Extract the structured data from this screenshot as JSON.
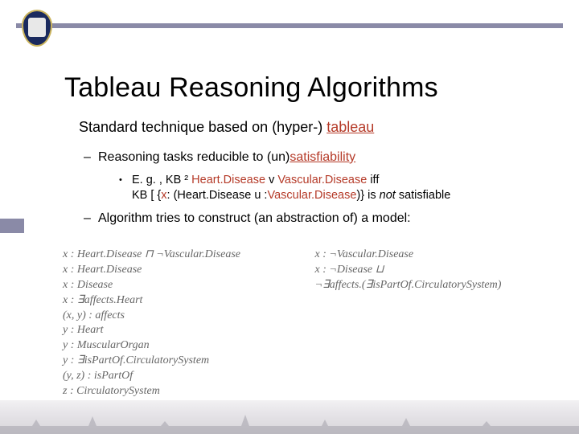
{
  "header": {
    "title": "Tableau Reasoning Algorithms"
  },
  "body": {
    "main_line_pre": "Standard technique based on (hyper-) ",
    "main_line_hl": "tableau",
    "bullet1_pre": "Reasoning tasks reducible to (un)",
    "bullet1_hl": "satisfiability",
    "example": {
      "l1_pre": "E. g. , KB ",
      "l1_sym1": "²",
      "l1_a": " Heart.Disease ",
      "l1_v": "v",
      "l1_b": " Vascular.Disease",
      "l1_iff": " iff",
      "l2_pre": "KB ",
      "l2_sym": "[ {",
      "l2_x": "x",
      "l2_mid1": ": (Heart.Disease ",
      "l2_u": "u",
      "l2_mid2": " :",
      "l2_v": "Vascular.Disease",
      "l2_end": ")} is ",
      "l2_not": "not",
      "l2_sat": " satisfiable"
    },
    "bullet2": "Algorithm tries to construct (an abstraction of) a model:"
  },
  "math": {
    "left": [
      "x : Heart.Disease ⊓ ¬Vascular.Disease",
      "x : Heart.Disease",
      "x : Disease",
      "x : ∃affects.Heart",
      "(x, y) : affects",
      "y : Heart",
      "y : MuscularOrgan",
      "y : ∃isPartOf.CirculatorySystem",
      "(y, z) : isPartOf",
      "z : CirculatorySystem"
    ],
    "right": [
      "x : ¬Vascular.Disease",
      "x : ¬Disease ⊔",
      "   ¬∃affects.(∃isPartOf.CirculatorySystem)"
    ]
  }
}
